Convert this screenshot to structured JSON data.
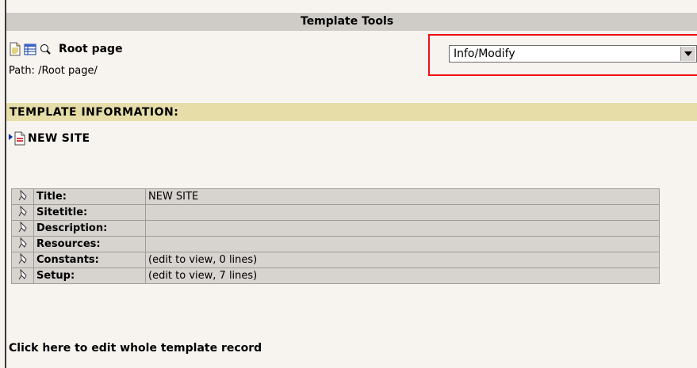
{
  "header": {
    "title": "Template Tools"
  },
  "page": {
    "title": "Root page",
    "path": "Path: /Root page/"
  },
  "function_menu": {
    "selected": "Info/Modify"
  },
  "section": {
    "title": "TEMPLATE INFORMATION:"
  },
  "template": {
    "title": "NEW SITE"
  },
  "table": {
    "rows": [
      {
        "label": "Title:",
        "value": "NEW SITE"
      },
      {
        "label": "Sitetitle:",
        "value": ""
      },
      {
        "label": "Description:",
        "value": ""
      },
      {
        "label": "Resources:",
        "value": ""
      },
      {
        "label": "Constants:",
        "value": "(edit to view, 0 lines)"
      },
      {
        "label": "Setup:",
        "value": "(edit to view, 7 lines)"
      }
    ]
  },
  "footer": {
    "edit_link": "Click here to edit whole template record"
  },
  "colors": {
    "highlight": "#ee1111",
    "section_bar": "#e7dda8",
    "header_bar": "#cfcbc7"
  }
}
